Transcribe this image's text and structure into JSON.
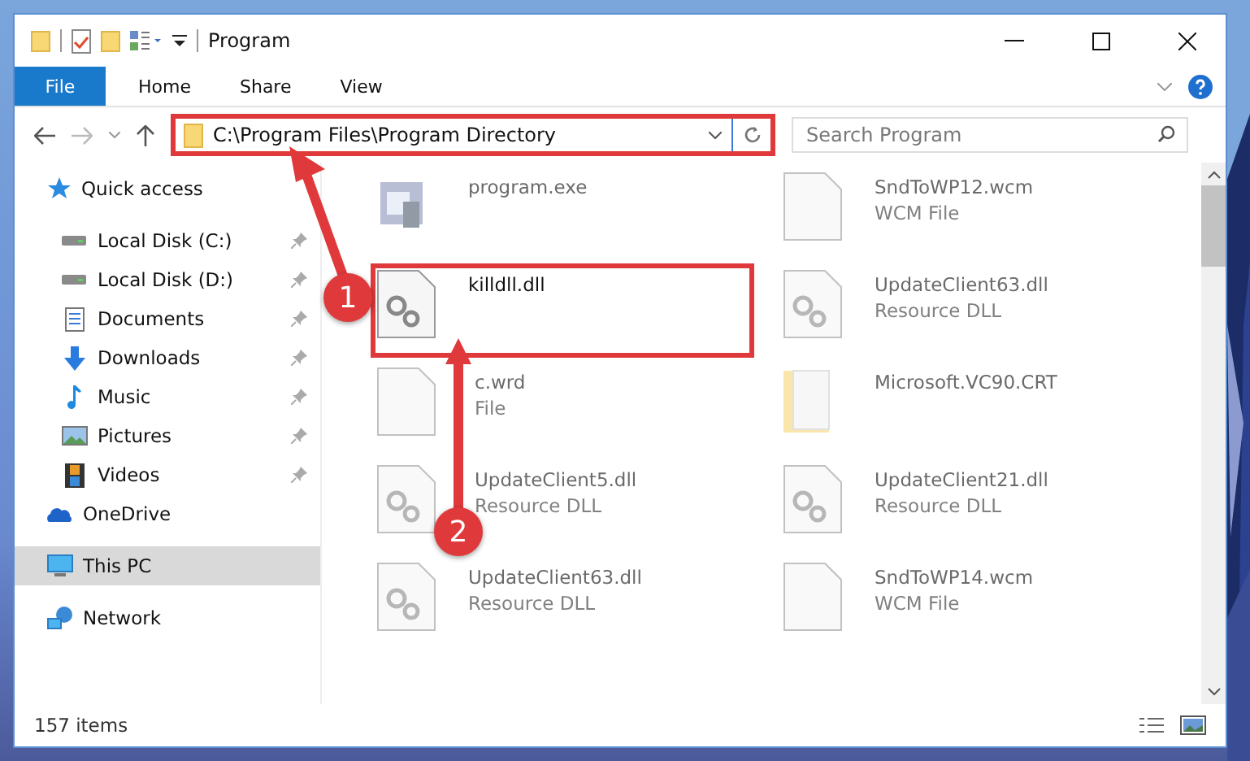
{
  "window": {
    "title": "Program"
  },
  "ribbon": {
    "file_tab": "File",
    "tabs": [
      "Home",
      "Share",
      "View"
    ]
  },
  "address_bar": {
    "path": "C:\\Program Files\\Program Directory",
    "highlighted": true
  },
  "search": {
    "placeholder": "Search Program"
  },
  "nav": [
    {
      "label": "Quick access",
      "kind": "star",
      "selected": false,
      "children": [
        {
          "label": "Local Disk (C:)",
          "kind": "drive",
          "pinned": true
        },
        {
          "label": "Local Disk (D:)",
          "kind": "drive",
          "pinned": true
        },
        {
          "label": "Documents",
          "kind": "doc",
          "pinned": true
        },
        {
          "label": "Downloads",
          "kind": "download",
          "pinned": true
        },
        {
          "label": "Music",
          "kind": "music",
          "pinned": true
        },
        {
          "label": "Pictures",
          "pinned": true
        },
        {
          "label": "Videos",
          "kind": "film",
          "pinned": true
        }
      ]
    },
    {
      "label": "OneDrive",
      "kind": "cloud",
      "selected": false
    },
    {
      "label": "This PC",
      "kind": "pc",
      "selected": true
    },
    {
      "label": "Network",
      "kind": "network",
      "selected": false
    }
  ],
  "files": [
    {
      "name": "program.exe",
      "kind": "exe",
      "blurred": true,
      "highlighted": false
    },
    {
      "name": "SndToWP12.wcm",
      "type": "WCM File",
      "kind": "blank",
      "blurred": true,
      "highlighted": false
    },
    {
      "name": "killdll.dll",
      "kind": "dll",
      "blurred": false,
      "highlighted": true
    },
    {
      "name": "UpdateClient63.dll",
      "type": "Resource DLL",
      "kind": "dll",
      "blurred": true,
      "highlighted": false
    },
    {
      "name": "c.wrd",
      "type": "File",
      "kind": "blank",
      "blurred": true,
      "highlighted": false
    },
    {
      "name": "Microsoft.VC90.CRT",
      "kind": "folder",
      "blurred": true,
      "highlighted": false
    },
    {
      "name": "UpdateClient5.dll",
      "type": "Resource DLL",
      "kind": "dll",
      "blurred": true,
      "highlighted": false
    },
    {
      "name": "UpdateClient21.dll",
      "type": "Resource DLL",
      "kind": "dll",
      "blurred": true,
      "highlighted": false
    },
    {
      "name": "UpdateClient63.dll",
      "type": "Resource DLL",
      "kind": "dll",
      "blurred": true,
      "highlighted": false
    },
    {
      "name": "SndToWP14.wcm",
      "type": "WCM File",
      "kind": "blank",
      "blurred": true,
      "highlighted": false
    }
  ],
  "callouts": [
    "1",
    "2"
  ],
  "status_bar": {
    "count": "157 items"
  }
}
